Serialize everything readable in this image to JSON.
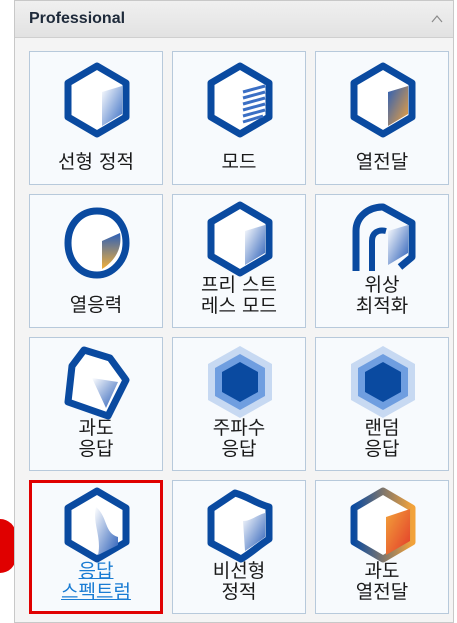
{
  "panel": {
    "title": "Professional",
    "tiles": [
      {
        "label": "선형 정적",
        "icon": "linear-static-icon"
      },
      {
        "label": "모드",
        "icon": "modal-icon"
      },
      {
        "label": "열전달",
        "icon": "heat-transfer-icon"
      },
      {
        "label": "열응력",
        "icon": "thermal-stress-icon"
      },
      {
        "label": "프리 스트\n레스 모드",
        "icon": "prestress-modal-icon"
      },
      {
        "label": "위상\n최적화",
        "icon": "topology-optimization-icon"
      },
      {
        "label": "과도\n응답",
        "icon": "transient-response-icon"
      },
      {
        "label": "주파수\n응답",
        "icon": "frequency-response-icon"
      },
      {
        "label": "랜덤\n응답",
        "icon": "random-response-icon"
      },
      {
        "label": "응답\n스펙트럼",
        "icon": "response-spectrum-icon"
      },
      {
        "label": "비선형\n정적",
        "icon": "nonlinear-static-icon"
      },
      {
        "label": "과도\n열전달",
        "icon": "transient-heat-transfer-icon"
      }
    ],
    "selected_label": "응답\n스펙트럼"
  },
  "colors": {
    "icon_blue": "#0a4aa0",
    "selection_red": "#e00000",
    "link_blue": "#1a7cd3"
  }
}
